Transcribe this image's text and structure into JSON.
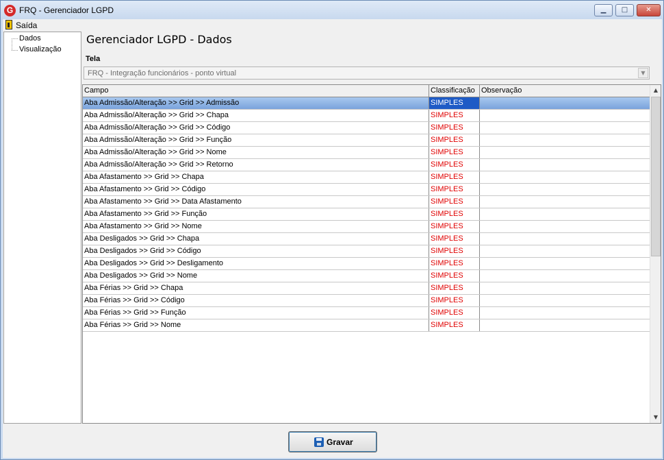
{
  "window": {
    "title": "FRQ - Gerenciador LGPD",
    "app_icon_letter": "G",
    "min_icon": "minimize-icon",
    "max_icon": "maximize-icon",
    "close_icon": "close-icon"
  },
  "menu": {
    "exit_label": "Saída"
  },
  "tree": {
    "items": [
      {
        "label": "Dados"
      },
      {
        "label": "Visualização"
      }
    ]
  },
  "page": {
    "title": "Gerenciador LGPD - Dados"
  },
  "tela": {
    "label": "Tela",
    "value": "FRQ - Integração funcionários - ponto virtual"
  },
  "grid": {
    "columns": [
      "Campo",
      "Classificação",
      "Observação"
    ],
    "selected_row": 0,
    "rows": [
      {
        "campo": "Aba Admissão/Alteração >> Grid >> Admissão",
        "classificacao": "SIMPLES",
        "observacao": ""
      },
      {
        "campo": "Aba Admissão/Alteração >> Grid >> Chapa",
        "classificacao": "SIMPLES",
        "observacao": ""
      },
      {
        "campo": "Aba Admissão/Alteração >> Grid >> Código",
        "classificacao": "SIMPLES",
        "observacao": ""
      },
      {
        "campo": "Aba Admissão/Alteração >> Grid >> Função",
        "classificacao": "SIMPLES",
        "observacao": ""
      },
      {
        "campo": "Aba Admissão/Alteração >> Grid >> Nome",
        "classificacao": "SIMPLES",
        "observacao": ""
      },
      {
        "campo": "Aba Admissão/Alteração >> Grid >> Retorno",
        "classificacao": "SIMPLES",
        "observacao": ""
      },
      {
        "campo": "Aba Afastamento >> Grid >> Chapa",
        "classificacao": "SIMPLES",
        "observacao": ""
      },
      {
        "campo": "Aba Afastamento >> Grid >> Código",
        "classificacao": "SIMPLES",
        "observacao": ""
      },
      {
        "campo": "Aba Afastamento >> Grid >> Data Afastamento",
        "classificacao": "SIMPLES",
        "observacao": ""
      },
      {
        "campo": "Aba Afastamento >> Grid >> Função",
        "classificacao": "SIMPLES",
        "observacao": ""
      },
      {
        "campo": "Aba Afastamento >> Grid >> Nome",
        "classificacao": "SIMPLES",
        "observacao": ""
      },
      {
        "campo": "Aba Desligados >> Grid >> Chapa",
        "classificacao": "SIMPLES",
        "observacao": ""
      },
      {
        "campo": "Aba Desligados >> Grid >> Código",
        "classificacao": "SIMPLES",
        "observacao": ""
      },
      {
        "campo": "Aba Desligados >> Grid >> Desligamento",
        "classificacao": "SIMPLES",
        "observacao": ""
      },
      {
        "campo": "Aba Desligados >> Grid >> Nome",
        "classificacao": "SIMPLES",
        "observacao": ""
      },
      {
        "campo": "Aba Férias >> Grid >> Chapa",
        "classificacao": "SIMPLES",
        "observacao": ""
      },
      {
        "campo": "Aba Férias >> Grid >> Código",
        "classificacao": "SIMPLES",
        "observacao": ""
      },
      {
        "campo": "Aba Férias >> Grid >> Função",
        "classificacao": "SIMPLES",
        "observacao": ""
      },
      {
        "campo": "Aba Férias >> Grid >> Nome",
        "classificacao": "SIMPLES",
        "observacao": ""
      }
    ]
  },
  "actions": {
    "save_label": "Gravar",
    "save_icon": "floppy-disk-icon"
  },
  "colors": {
    "classification_text": "#e00000",
    "selected_row": "#7aa3dc",
    "selected_cell": "#1e5bc6"
  }
}
